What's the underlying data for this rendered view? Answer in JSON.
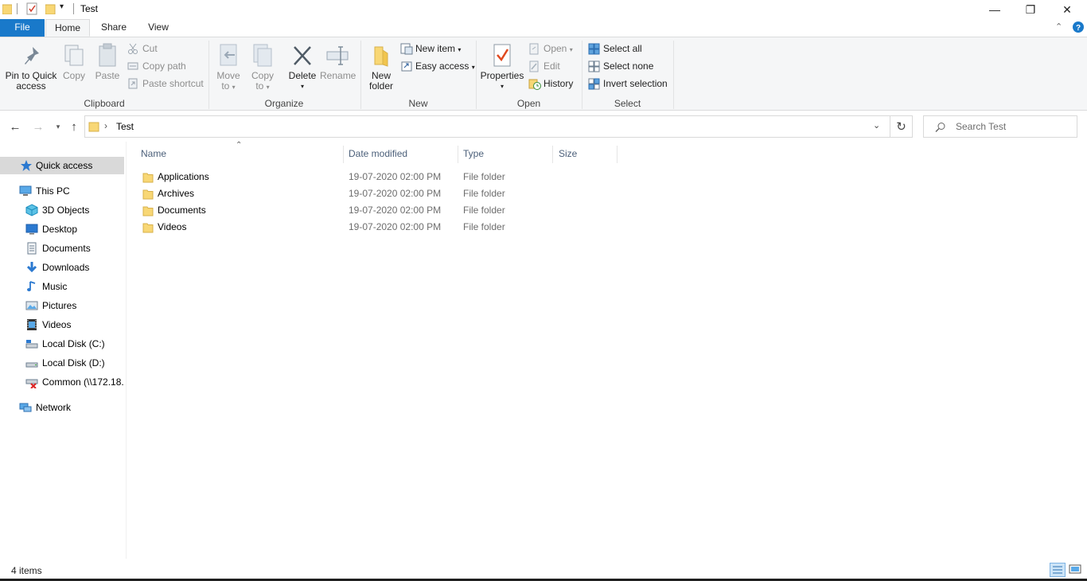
{
  "window": {
    "title": "Test",
    "minimize_glyph": "—",
    "maximize_glyph": "❐",
    "close_glyph": "✕"
  },
  "tabs": {
    "file": "File",
    "home": "Home",
    "share": "Share",
    "view": "View"
  },
  "ribbon": {
    "clipboard": {
      "label": "Clipboard",
      "pin_line1": "Pin to Quick",
      "pin_line2": "access",
      "copy": "Copy",
      "paste": "Paste",
      "cut": "Cut",
      "copy_path": "Copy path",
      "paste_shortcut": "Paste shortcut"
    },
    "organize": {
      "label": "Organize",
      "move_line1": "Move",
      "move_line2": "to",
      "copy_line1": "Copy",
      "copy_line2": "to",
      "delete": "Delete",
      "rename": "Rename"
    },
    "new": {
      "label": "New",
      "new_folder_line1": "New",
      "new_folder_line2": "folder",
      "new_item": "New item",
      "easy_access": "Easy access"
    },
    "open": {
      "label": "Open",
      "properties": "Properties",
      "open": "Open",
      "edit": "Edit",
      "history": "History"
    },
    "select": {
      "label": "Select",
      "select_all": "Select all",
      "select_none": "Select none",
      "invert_selection": "Invert selection"
    }
  },
  "address": {
    "separator": "›",
    "crumb": "Test",
    "search_placeholder": "Search Test"
  },
  "nav": {
    "quick_access": "Quick access",
    "this_pc": "This PC",
    "items": [
      {
        "label": "3D Objects",
        "icon": "3d-objects-icon"
      },
      {
        "label": "Desktop",
        "icon": "desktop-icon"
      },
      {
        "label": "Documents",
        "icon": "documents-icon"
      },
      {
        "label": "Downloads",
        "icon": "downloads-icon"
      },
      {
        "label": "Music",
        "icon": "music-icon"
      },
      {
        "label": "Pictures",
        "icon": "pictures-icon"
      },
      {
        "label": "Videos",
        "icon": "videos-icon"
      },
      {
        "label": "Local Disk (C:)",
        "icon": "drive-c-icon"
      },
      {
        "label": "Local Disk (D:)",
        "icon": "drive-d-icon"
      },
      {
        "label": "Common (\\\\172.18.",
        "icon": "network-drive-disconnected-icon"
      }
    ],
    "network": "Network"
  },
  "columns": {
    "name": "Name",
    "date_modified": "Date modified",
    "type": "Type",
    "size": "Size"
  },
  "files": [
    {
      "name": "Applications",
      "date": "19-07-2020 02:00 PM",
      "type": "File folder",
      "size": ""
    },
    {
      "name": "Archives",
      "date": "19-07-2020 02:00 PM",
      "type": "File folder",
      "size": ""
    },
    {
      "name": "Documents",
      "date": "19-07-2020 02:00 PM",
      "type": "File folder",
      "size": ""
    },
    {
      "name": "Videos",
      "date": "19-07-2020 02:00 PM",
      "type": "File folder",
      "size": ""
    }
  ],
  "status": {
    "item_count": "4 items"
  },
  "colors": {
    "accent": "#1979ca",
    "folder": "#f8d775",
    "selection": "#d9d9d9"
  }
}
